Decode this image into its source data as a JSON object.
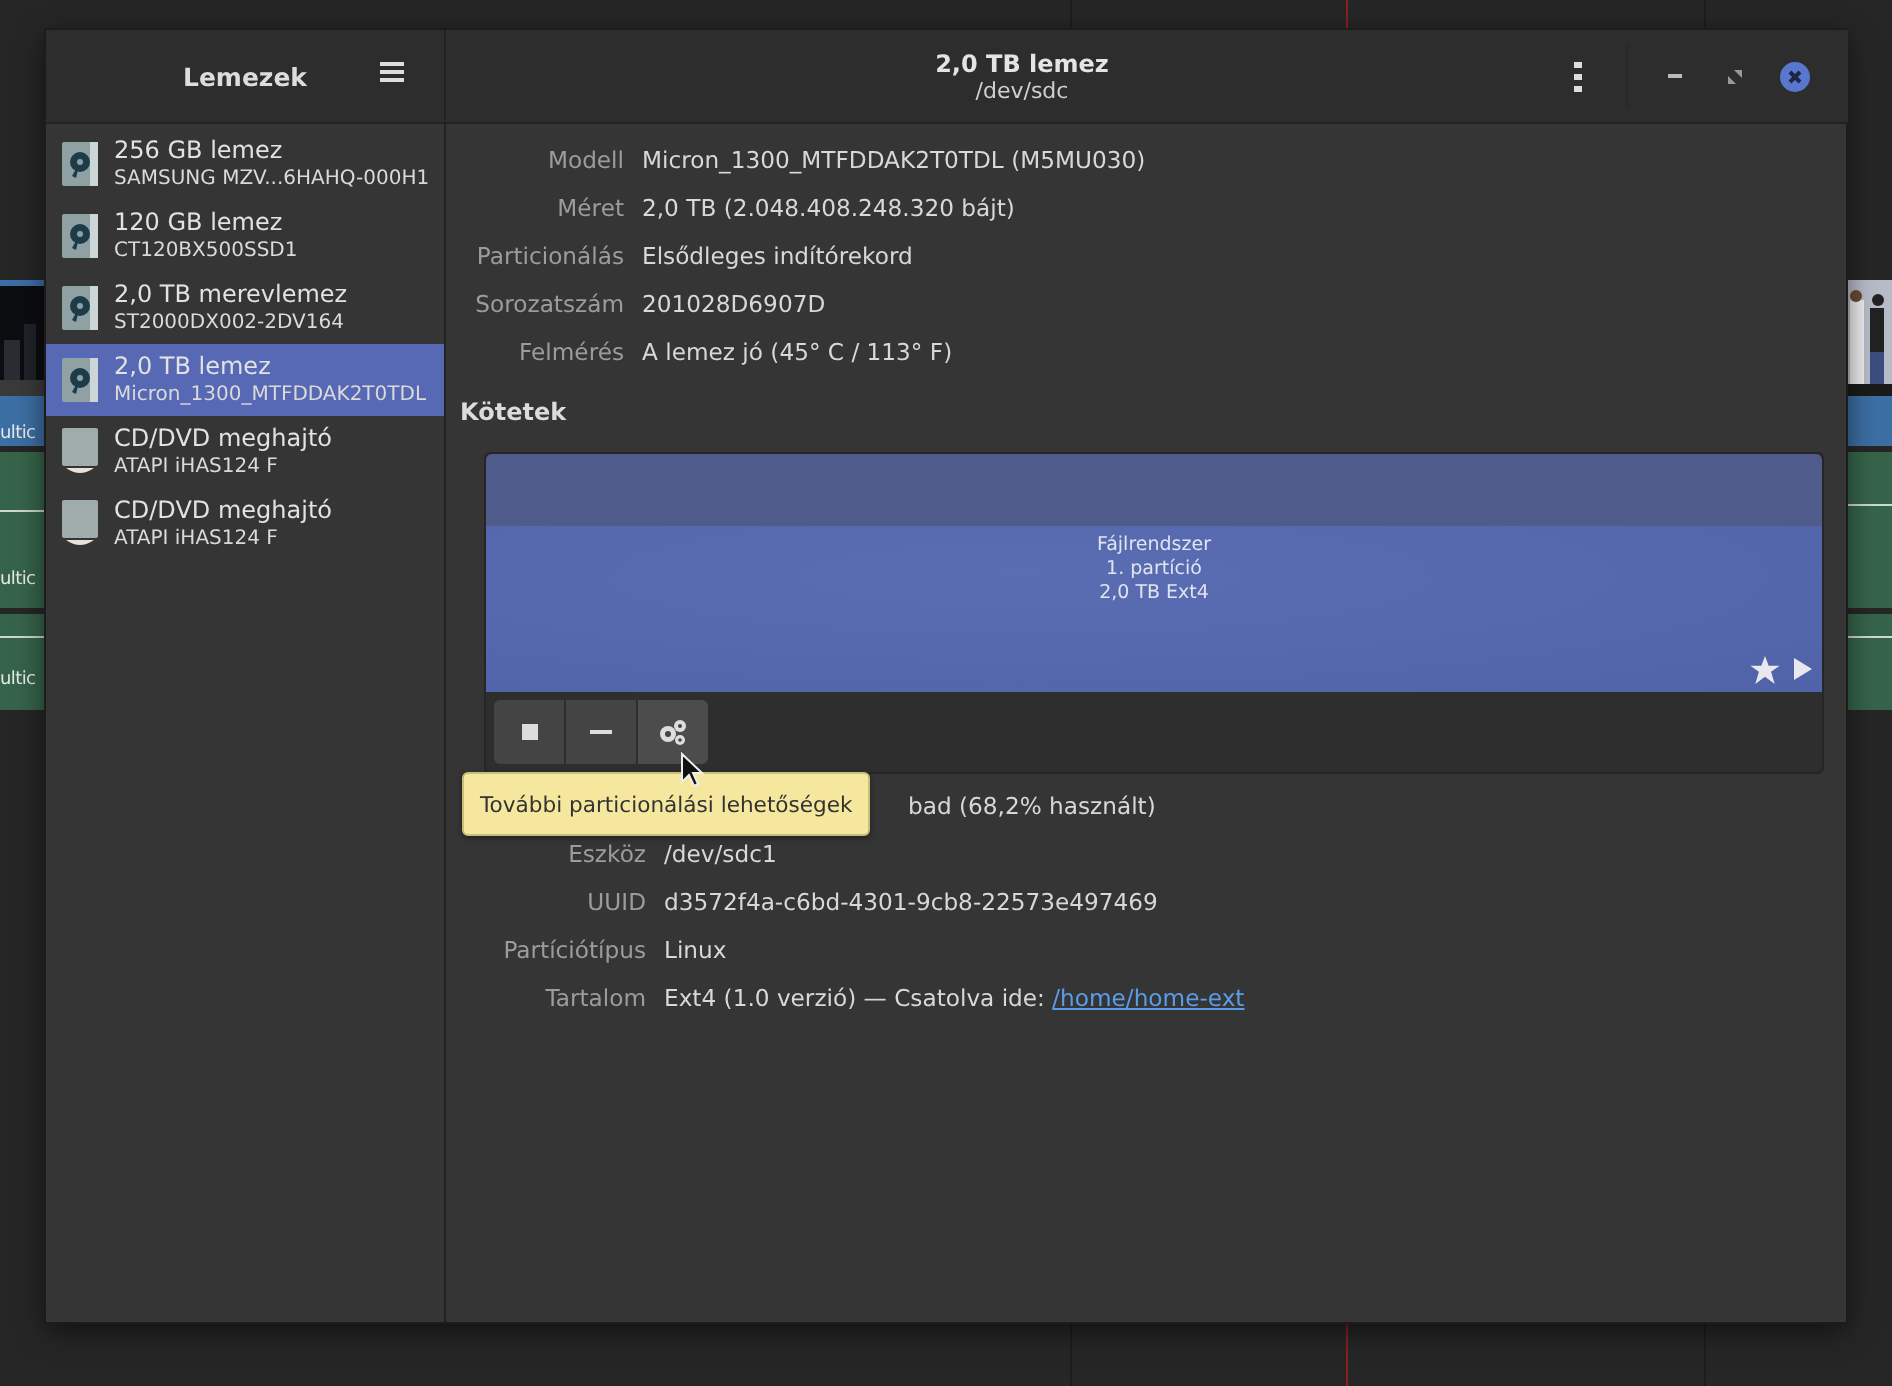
{
  "background": {
    "clip_labels": [
      "ultic",
      "ultic",
      "ultic"
    ]
  },
  "sidebar": {
    "title": "Lemezek",
    "items": [
      {
        "kind": "disk",
        "title": "256 GB lemez",
        "subtitle": "SAMSUNG MZV...6HAHQ-000H1",
        "selected": false
      },
      {
        "kind": "disk",
        "title": "120 GB lemez",
        "subtitle": "CT120BX500SSD1",
        "selected": false
      },
      {
        "kind": "disk",
        "title": "2,0 TB merevlemez",
        "subtitle": "ST2000DX002-2DV164",
        "selected": false
      },
      {
        "kind": "disk",
        "title": "2,0 TB lemez",
        "subtitle": "Micron_1300_MTFDDAK2T0TDL",
        "selected": true
      },
      {
        "kind": "optical",
        "title": "CD/DVD meghajtó",
        "subtitle": "ATAPI  iHAS124  F",
        "selected": false
      },
      {
        "kind": "optical",
        "title": "CD/DVD meghajtó",
        "subtitle": "ATAPI  iHAS124  F",
        "selected": false
      }
    ]
  },
  "header": {
    "title": "2,0 TB lemez",
    "subtitle": "/dev/sdc"
  },
  "drive_info": [
    {
      "label": "Modell",
      "value": "Micron_1300_MTFDDAK2T0TDL (M5MU030)"
    },
    {
      "label": "Méret",
      "value": "2,0 TB (2.048.408.248.320 bájt)"
    },
    {
      "label": "Particionálás",
      "value": "Elsődleges indítórekord"
    },
    {
      "label": "Sorozatszám",
      "value": "201028D6907D"
    },
    {
      "label": "Felmérés",
      "value": "A lemez jó (45° C / 113° F)"
    }
  ],
  "volumes": {
    "title": "Kötetek",
    "partition": {
      "lines": [
        "Fájlrendszer",
        "1. partíció",
        "2,0 TB Ext4"
      ],
      "selected": true
    },
    "toolbar": [
      {
        "kind": "stop"
      },
      {
        "kind": "minus"
      },
      {
        "kind": "gear"
      }
    ],
    "tooltip": "További particionálási lehetőségek"
  },
  "volume_info": [
    {
      "value": "bad (68,2% használt)"
    },
    {
      "label": "Eszköz",
      "value": "/dev/sdc1"
    },
    {
      "label": "UUID",
      "value": "d3572f4a-c6bd-4301-9cb8-22573e497469"
    },
    {
      "label": "Partíciótípus",
      "value": "Linux"
    },
    {
      "label": "Tartalom",
      "value": "Ext4 (1.0 verzió) — Csatolva ide: ",
      "link": "/home/home-ext"
    }
  ]
}
